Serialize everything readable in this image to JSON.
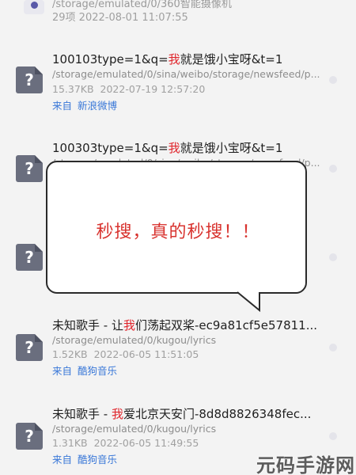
{
  "top_item": {
    "path": "/storage/emulated/0/360智能摄像机",
    "meta": "29项   2022-08-01 11:07:55"
  },
  "files": [
    {
      "title_before": "100103type=1&q=",
      "title_highlight": "我",
      "title_after": "就是饿小宝呀&t=1",
      "path": "/storage/emulated/0/sina/weibo/storage/newsfeed/p...",
      "size": "15.37KB",
      "date": "2022-07-19 12:57:20",
      "source_prefix": "来自",
      "source_app": "新浪微博",
      "icon": "question-mark-icon"
    },
    {
      "title_before": "100303type=1&q=",
      "title_highlight": "我",
      "title_after": "就是饿小宝呀&t=1",
      "path": "/storage/emulated/0/sina/weibo/storage/newsfeed/p...",
      "icon": "question-mark-icon"
    },
    {
      "icon": "question-mark-icon"
    },
    {
      "title_before": "未知歌手 - 让",
      "title_highlight": "我",
      "title_after": "们荡起双桨-ec9a81cf5e57811...",
      "path": "/storage/emulated/0/kugou/lyrics",
      "size": "1.52KB",
      "date": "2022-06-05 11:51:05",
      "source_prefix": "来自",
      "source_app": "酷狗音乐",
      "icon": "question-mark-icon"
    },
    {
      "title_before": "未知歌手 - ",
      "title_highlight": "我",
      "title_after": "爱北京天安门-8d8d8826348fec...",
      "path": "/storage/emulated/0/kugou/lyrics",
      "size": "1.31KB",
      "date": "2022-06-05 11:49:55",
      "source_prefix": "来自",
      "source_app": "酷狗音乐",
      "icon": "question-mark-icon"
    }
  ],
  "bubble": {
    "text": "秒搜，真的秒搜！！"
  },
  "watermark": "元码手游网",
  "colors": {
    "highlight": "#e0252c",
    "source_link": "#3a78d8",
    "bubble_text": "#d8322e",
    "icon_bg": "#6a6e7e"
  }
}
